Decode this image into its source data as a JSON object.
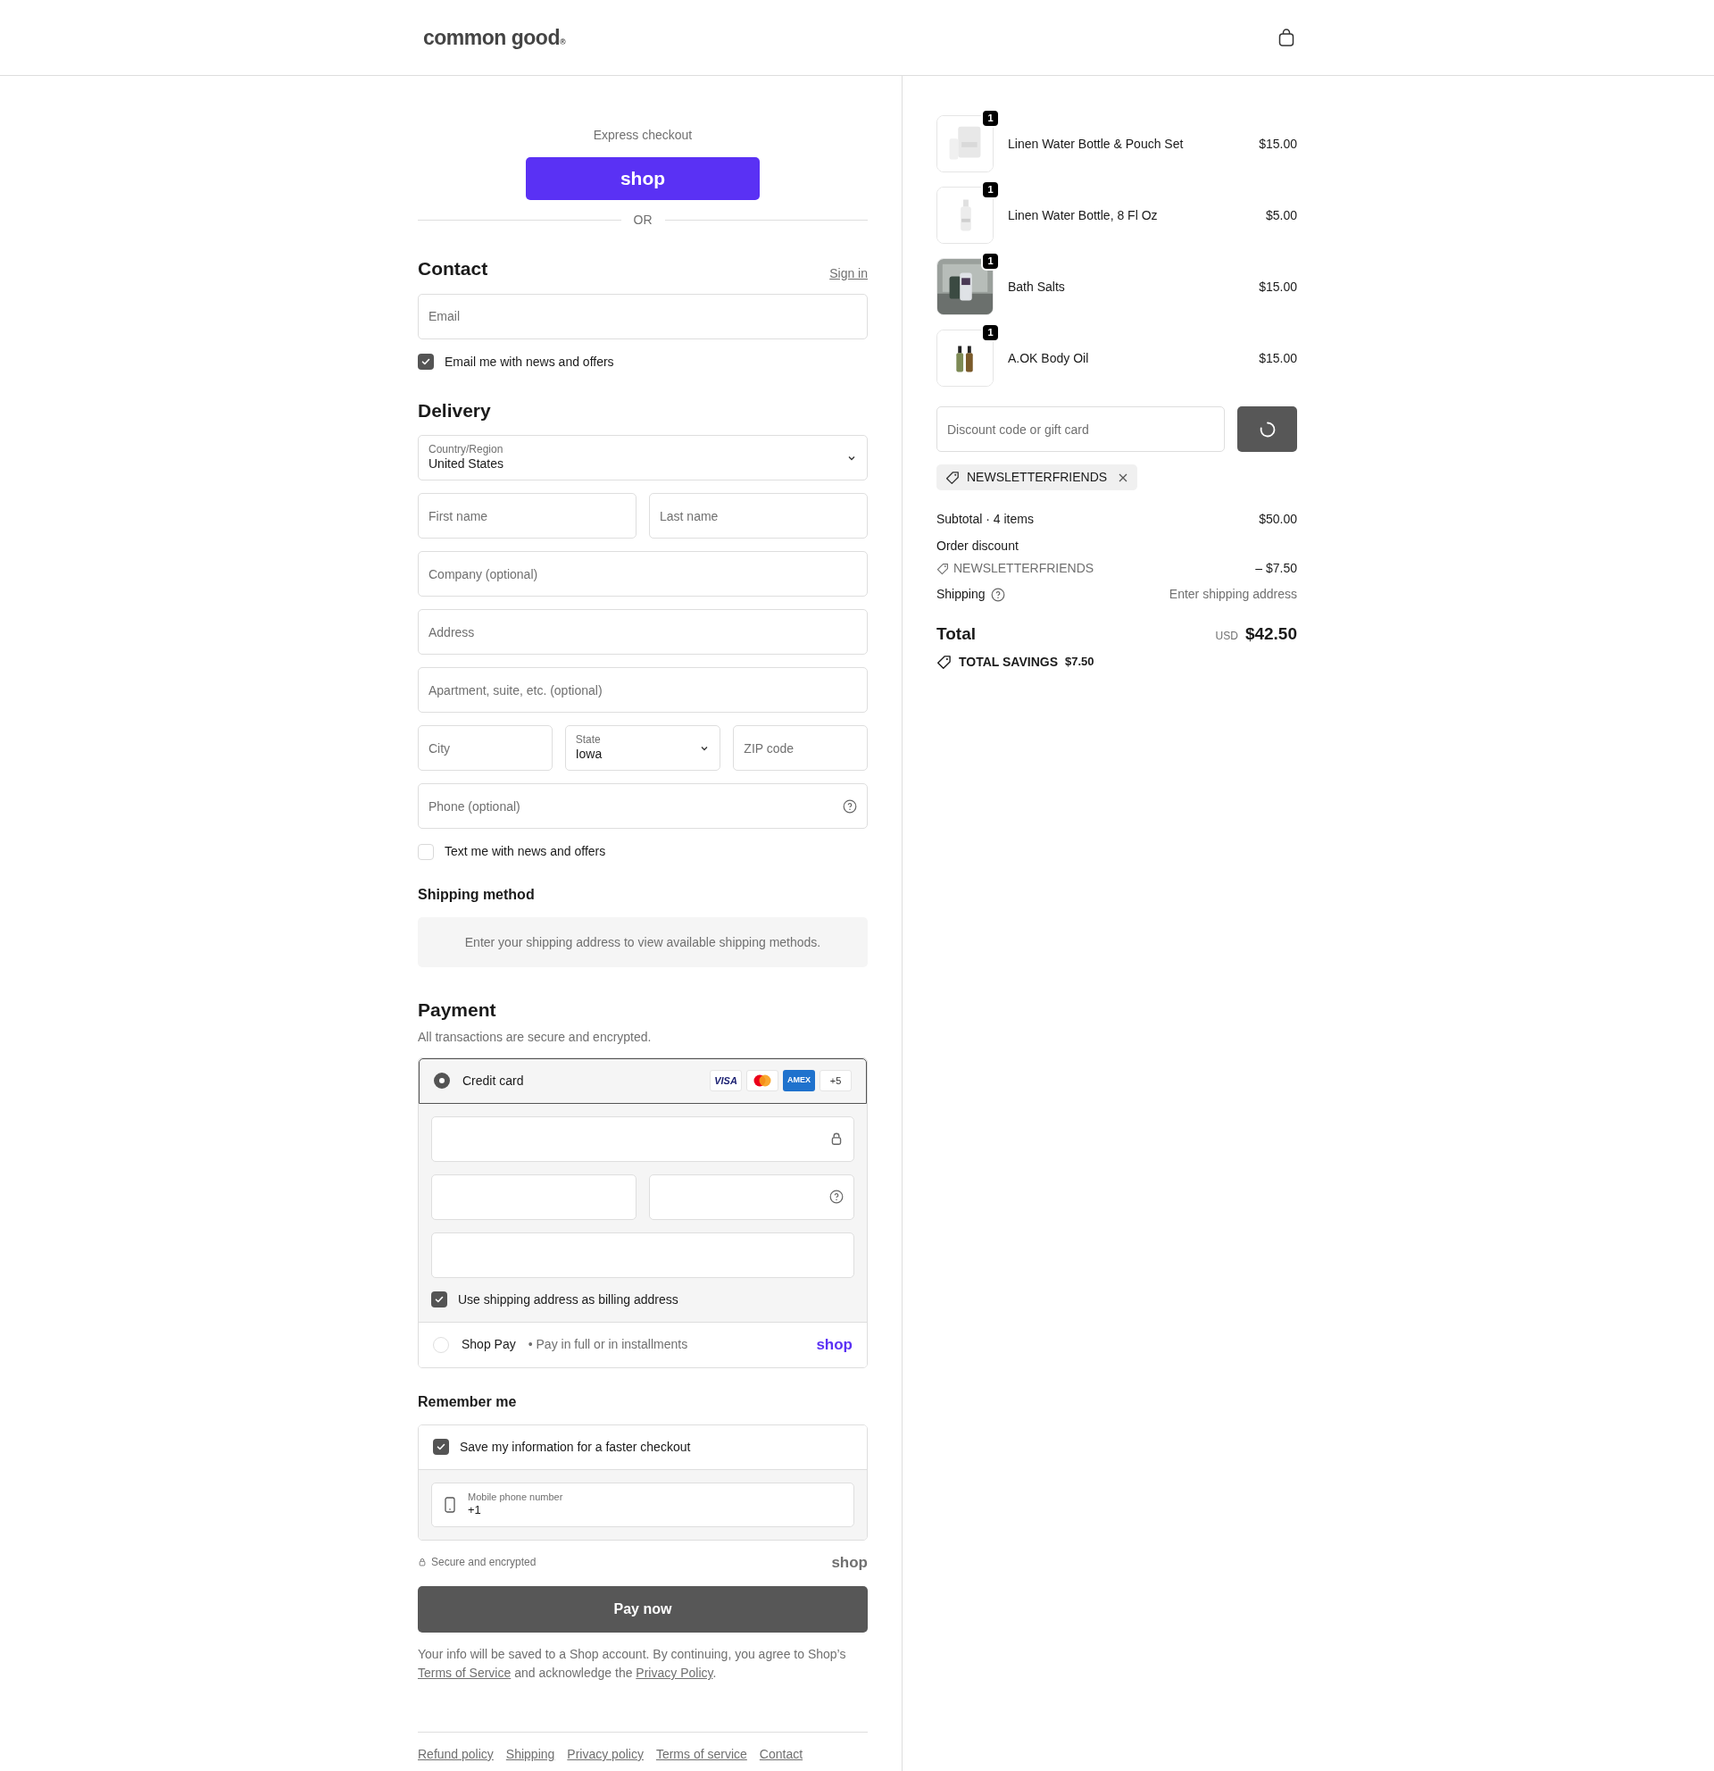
{
  "header": {
    "logo": "common good",
    "logo_mark": "®"
  },
  "express": {
    "title": "Express checkout",
    "button": "shop",
    "divider": "OR"
  },
  "contact": {
    "title": "Contact",
    "sign_in": "Sign in",
    "email": {
      "placeholder": "Email"
    },
    "news": {
      "label": "Email me with news and offers",
      "checked": true
    }
  },
  "delivery": {
    "title": "Delivery",
    "country": {
      "label": "Country/Region",
      "value": "United States"
    },
    "first_name": {
      "placeholder": "First name"
    },
    "last_name": {
      "placeholder": "Last name"
    },
    "company": {
      "placeholder": "Company (optional)"
    },
    "address": {
      "placeholder": "Address"
    },
    "apartment": {
      "placeholder": "Apartment, suite, etc. (optional)"
    },
    "city": {
      "placeholder": "City"
    },
    "state": {
      "label": "State",
      "value": "Iowa"
    },
    "zip": {
      "placeholder": "ZIP code"
    },
    "phone": {
      "placeholder": "Phone (optional)"
    },
    "text_offers": {
      "label": "Text me with news and offers",
      "checked": false
    }
  },
  "shipping_method": {
    "title": "Shipping method",
    "notice": "Enter your shipping address to view available shipping methods."
  },
  "payment": {
    "title": "Payment",
    "subtitle": "All transactions are secure and encrypted.",
    "methods": [
      {
        "kind": "card",
        "label": "Credit card",
        "selected": true,
        "brands": [
          {
            "kind": "visa",
            "label": "VISA"
          },
          {
            "kind": "mastercard"
          },
          {
            "kind": "amex",
            "label": "AMEX"
          },
          {
            "kind": "more",
            "label": "+5"
          }
        ],
        "billing": {
          "label": "Use shipping address as billing address",
          "checked": true
        }
      },
      {
        "kind": "shop_pay",
        "label": "Shop Pay",
        "separator": "•",
        "note": "Pay in full or in installments",
        "logo": "shop",
        "selected": false
      }
    ]
  },
  "remember": {
    "title": "Remember me",
    "save": {
      "label": "Save my information for a faster checkout",
      "checked": true
    },
    "mobile": {
      "label": "Mobile phone number",
      "value": "+1"
    }
  },
  "secure": {
    "label": "Secure and encrypted",
    "logo": "shop"
  },
  "pay_button": "Pay now",
  "legal": "Your info will be saved to a Shop account. By continuing, you agree to Shop’s",
  "legal_links": [
    "Terms of Service",
    "and acknowledge the",
    "Privacy Policy",
    "."
  ],
  "footer_links": [
    "Refund policy",
    "Shipping",
    "Privacy policy",
    "Terms of service",
    "Contact"
  ],
  "cart": {
    "items": [
      {
        "name": "Linen Water Bottle & Pouch Set",
        "price": "$15.00",
        "quantity": "1"
      },
      {
        "name": "Linen Water Bottle, 8 Fl Oz",
        "price": "$5.00",
        "quantity": "1"
      },
      {
        "name": "Bath Salts",
        "price": "$15.00",
        "quantity": "1"
      },
      {
        "name": "A.OK Body Oil",
        "price": "$15.00",
        "quantity": "1"
      }
    ],
    "discount": {
      "placeholder": "Discount code or gift card"
    },
    "applied_code": "NEWSLETTERFRIENDS",
    "subtotal": {
      "label": "Subtotal · 4 items",
      "value": "$50.00"
    },
    "order_discount": {
      "label": "Order discount",
      "code": "NEWSLETTERFRIENDS",
      "value": "– $7.50"
    },
    "shipping": {
      "label": "Shipping",
      "value": "Enter shipping address"
    },
    "total": {
      "label": "Total",
      "currency": "USD",
      "value": "$42.50"
    },
    "savings": {
      "label": "TOTAL SAVINGS",
      "value": "$7.50"
    }
  }
}
